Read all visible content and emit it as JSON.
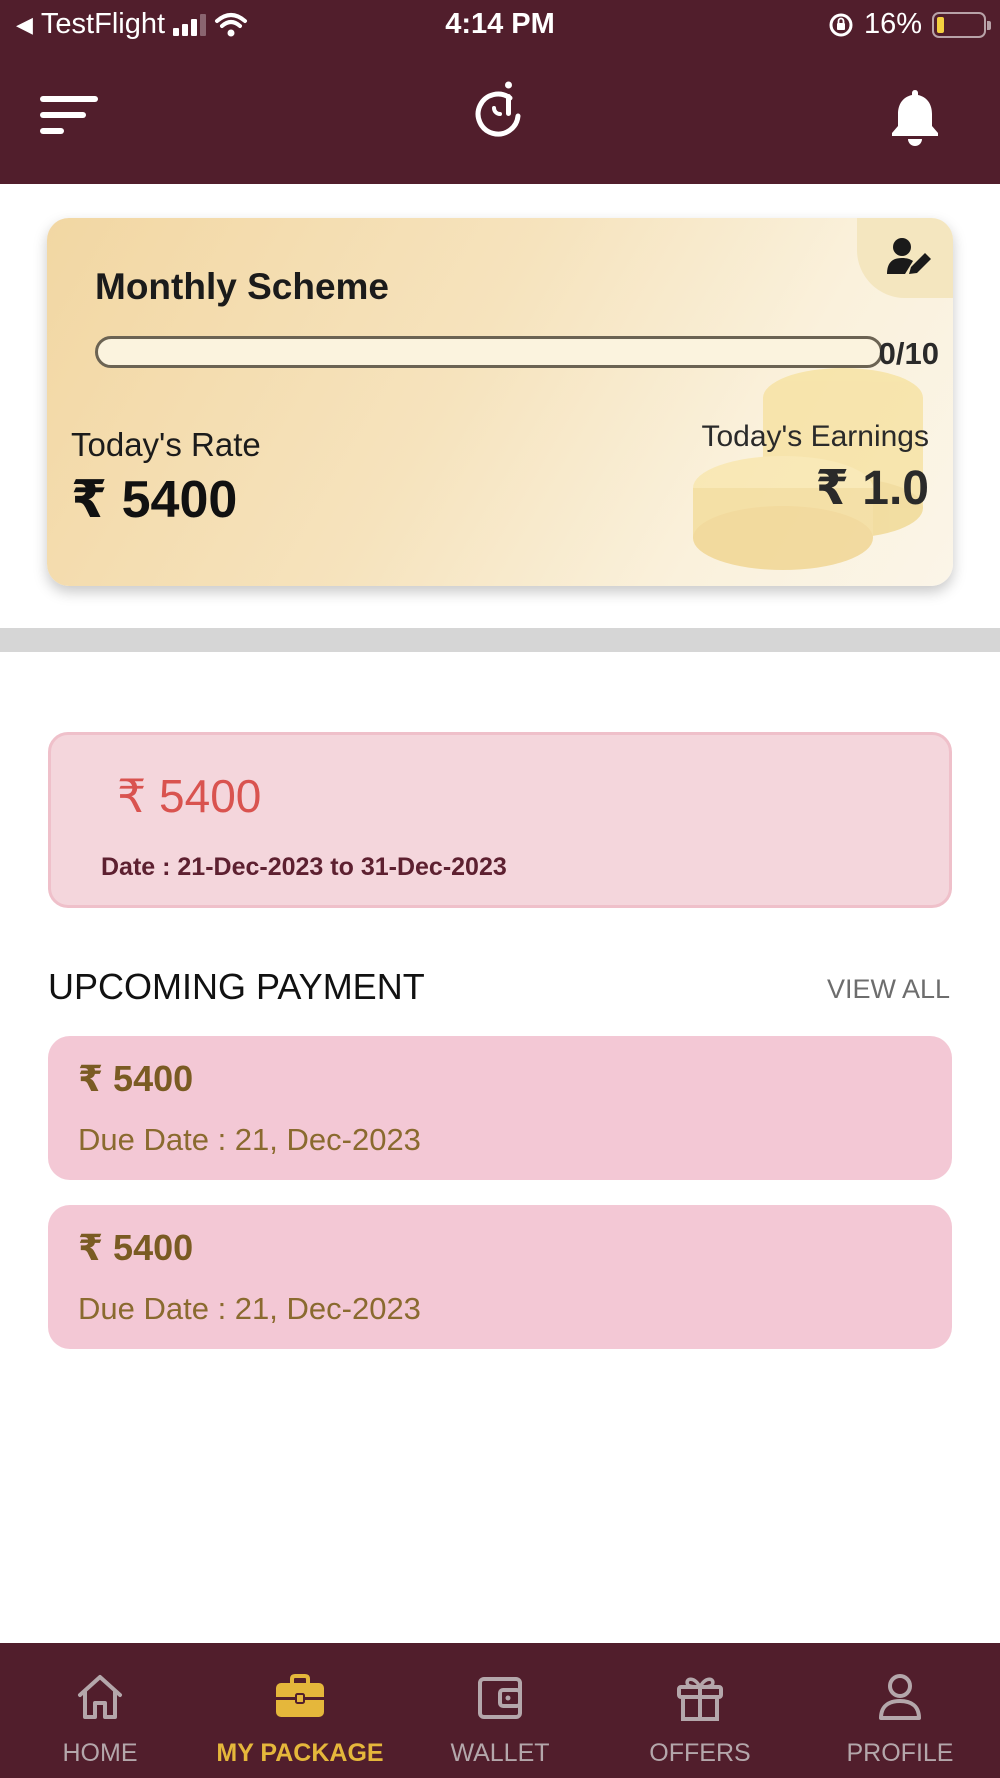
{
  "status_bar": {
    "back_app": "TestFlight",
    "time": "4:14 PM",
    "battery": "16%"
  },
  "colors": {
    "brand": "#511e2c",
    "active_tab": "#e5b73b",
    "current_amount": "#d9534f",
    "payment_card": "#f3c8d5"
  },
  "header": {
    "menu_icon": "hamburger-menu-icon",
    "logo_icon": "app-logo-icon",
    "notification_icon": "bell-icon"
  },
  "scheme": {
    "title": "Monthly Scheme",
    "progress_text": "0/10",
    "progress_fraction": 0,
    "edit_icon": "user-edit-icon",
    "rate_label": "Today's Rate",
    "rate_value": "₹ 5400",
    "earnings_label": "Today's Earnings",
    "earnings_value": "₹ 1.0"
  },
  "current_payment": {
    "amount": "₹ 5400",
    "date": "Date : 21-Dec-2023  to  31-Dec-2023"
  },
  "upcoming": {
    "title": "UPCOMING PAYMENT",
    "view_all": "VIEW ALL",
    "items": [
      {
        "amount": "₹ 5400",
        "due": "Due Date  : 21, Dec-2023"
      },
      {
        "amount": "₹ 5400",
        "due": "Due Date  : 21, Dec-2023"
      }
    ]
  },
  "nav": [
    {
      "label": "HOME",
      "icon": "home-icon",
      "active": false
    },
    {
      "label": "MY PACKAGE",
      "icon": "briefcase-icon",
      "active": true
    },
    {
      "label": "WALLET",
      "icon": "wallet-icon",
      "active": false
    },
    {
      "label": "OFFERS",
      "icon": "gift-icon",
      "active": false
    },
    {
      "label": "PROFILE",
      "icon": "user-icon",
      "active": false
    }
  ]
}
